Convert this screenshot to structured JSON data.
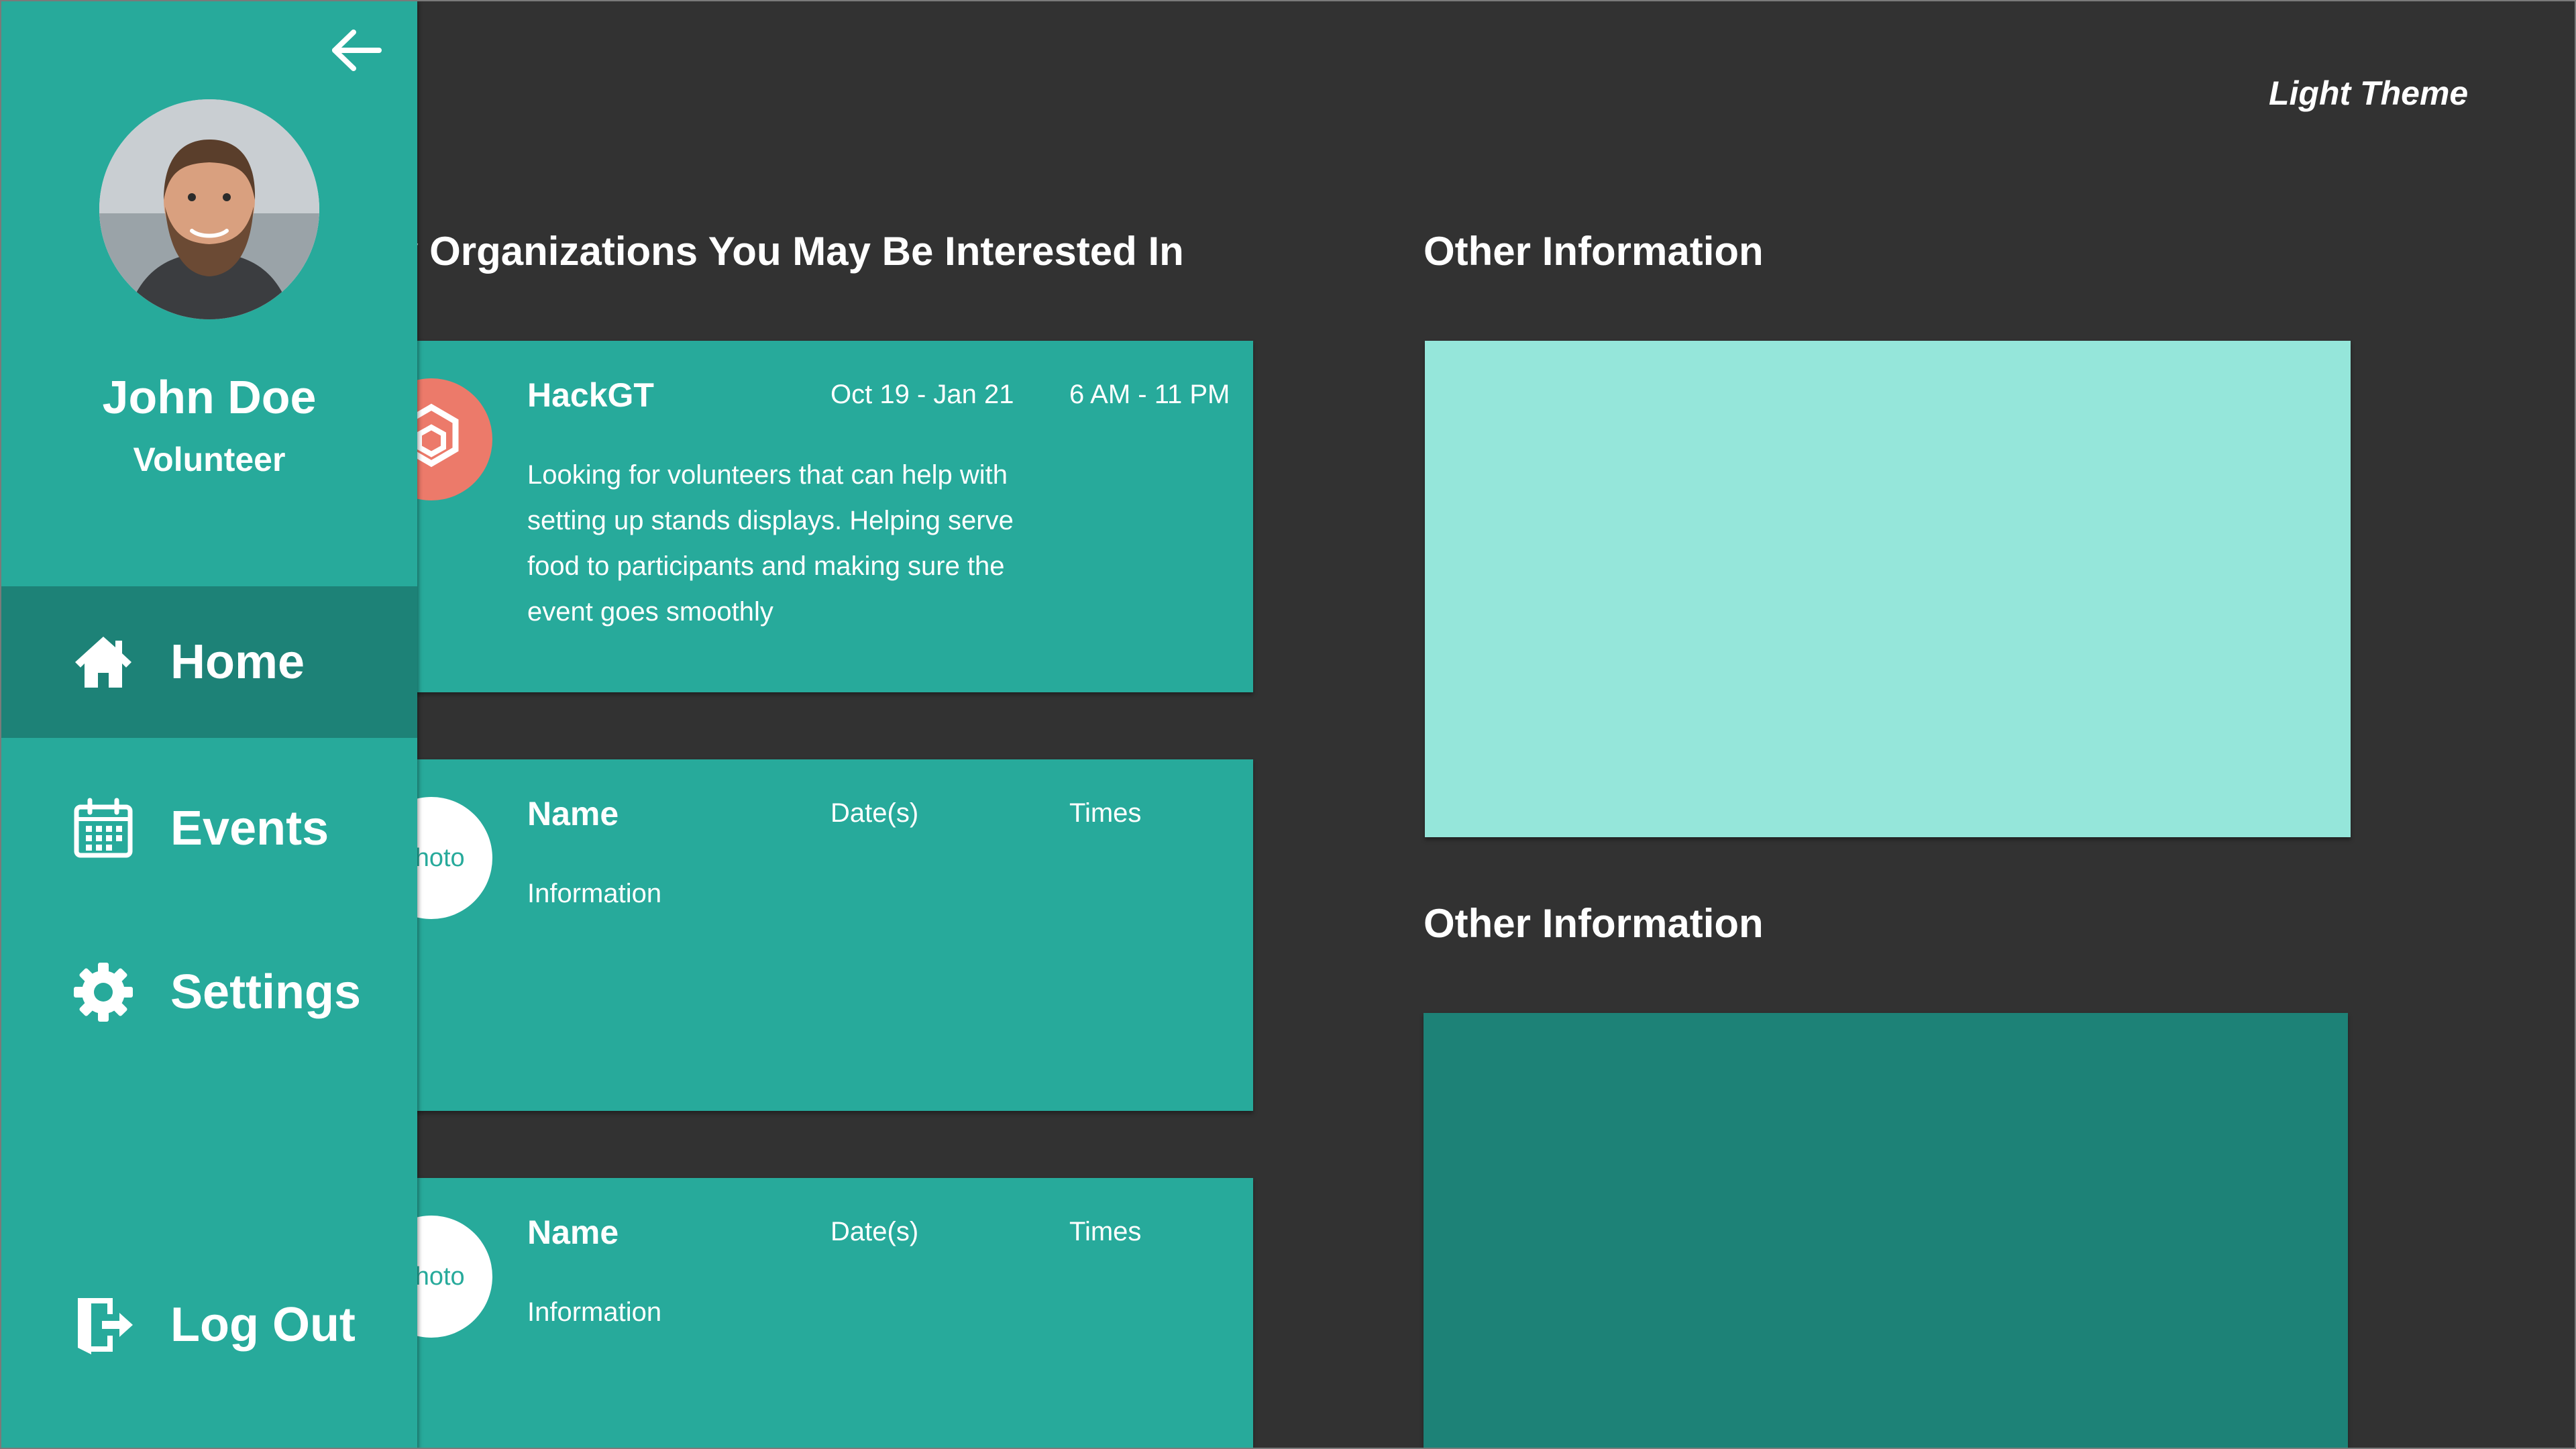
{
  "header": {
    "theme_toggle": "Light Theme"
  },
  "sidebar": {
    "back_icon": "arrow-left-icon",
    "user": {
      "name": "John Doe",
      "role": "Volunteer"
    },
    "nav": [
      {
        "label": "Home",
        "icon": "home-icon",
        "active": true
      },
      {
        "label": "Events",
        "icon": "calendar-icon",
        "active": false
      },
      {
        "label": "Settings",
        "icon": "gear-icon",
        "active": false
      }
    ],
    "logout": {
      "label": "Log Out",
      "icon": "logout-icon"
    }
  },
  "main": {
    "organizations_title": "Nearby Organizations You May Be Interested In",
    "organizations": [
      {
        "photo": "",
        "logo": "hexagon-logo",
        "name": "HackGT",
        "dates": "Oct 19 - Jan 21",
        "times": "6 AM - 11 PM",
        "info": "Looking for volunteers that can help with setting up stands displays. Helping serve food to participants and making sure the event goes smoothly"
      },
      {
        "photo": "Photo",
        "name": "Name",
        "dates": "Date(s)",
        "times": "Times",
        "info": "Information"
      },
      {
        "photo": "Photo",
        "name": "Name",
        "dates": "Date(s)",
        "times": "Times",
        "info": "Information"
      }
    ],
    "other_info": [
      {
        "title": "Other Information"
      },
      {
        "title": "Other Information"
      }
    ]
  },
  "colors": {
    "background": "#323232",
    "primary": "#27aa9b",
    "primary_dark": "#1d8277",
    "light_panel": "#95e6da",
    "logo": "#ec7a6a",
    "text": "#ffffff"
  }
}
